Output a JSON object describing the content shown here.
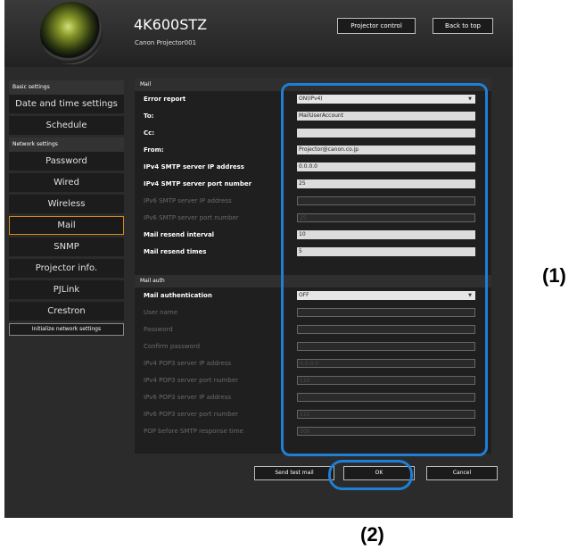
{
  "header": {
    "model": "4K600STZ",
    "projector_name": "Canon Projector001",
    "projector_control_label": "Projector control",
    "back_to_top_label": "Back to top"
  },
  "sidebar": {
    "basic_settings_label": "Basic settings",
    "basic_items": [
      "Date and time settings",
      "Schedule"
    ],
    "network_settings_label": "Network settings",
    "network_items": [
      "Password",
      "Wired",
      "Wireless",
      "Mail",
      "SNMP",
      "Projector info.",
      "PJLink",
      "Crestron"
    ],
    "selected_item": "Mail",
    "init_label": "Initialize network settings"
  },
  "mail": {
    "title": "Mail",
    "rows": [
      {
        "label": "Error report",
        "value": "ON(IPv4)"
      },
      {
        "label": "To:",
        "value": "MailUserAccount"
      },
      {
        "label": "Cc:",
        "value": ""
      },
      {
        "label": "From:",
        "value": "Projector@canon.co.jp"
      },
      {
        "label": "IPv4 SMTP server IP address",
        "value": "0.0.0.0"
      },
      {
        "label": "IPv4 SMTP server port number",
        "value": "25"
      },
      {
        "label": "IPv6 SMTP server IP address",
        "value": ""
      },
      {
        "label": "IPv6 SMTP server port number",
        "value": "25"
      },
      {
        "label": "Mail resend interval",
        "value": "10"
      },
      {
        "label": "Mail resend times",
        "value": "5"
      }
    ]
  },
  "auth": {
    "title": "Mail auth",
    "rows": [
      {
        "label": "Mail authentication",
        "value": "OFF"
      },
      {
        "label": "User name",
        "value": ""
      },
      {
        "label": "Password",
        "value": ""
      },
      {
        "label": "Confirm password",
        "value": ""
      },
      {
        "label": "IPv4 POP3 server IP address",
        "value": "0.0.0.0"
      },
      {
        "label": "IPv4 POP3 server port number",
        "value": "110"
      },
      {
        "label": "IPv6 POP3 server IP address",
        "value": ""
      },
      {
        "label": "IPv6 POP3 server port number",
        "value": "110"
      },
      {
        "label": "POP before SMTP response time",
        "value": "300"
      }
    ]
  },
  "footer": {
    "send_test_mail_label": "Send test mail",
    "ok_label": "OK",
    "cancel_label": "Cancel"
  },
  "annotations": {
    "callout_1": "(1)",
    "callout_2": "(2)"
  },
  "colors": {
    "callout": "#1f7fd6",
    "selected_border": "#d48a1a"
  }
}
